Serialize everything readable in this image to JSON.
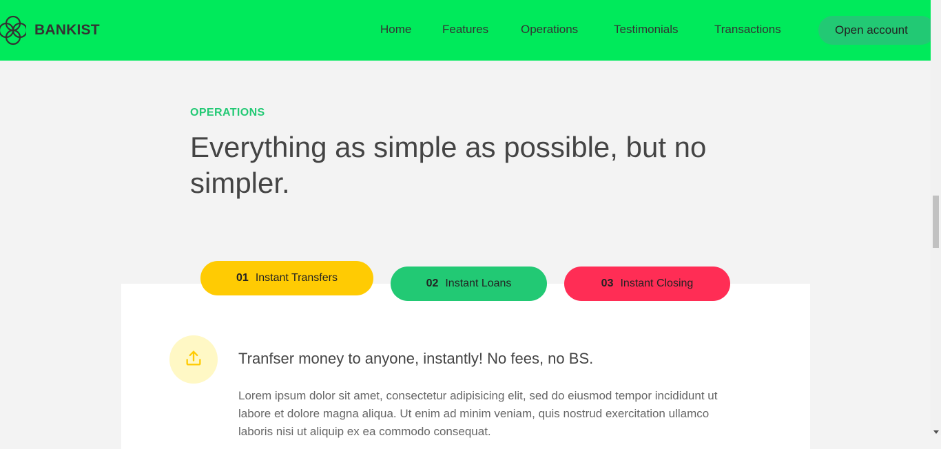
{
  "nav": {
    "brand": "BANKIST",
    "links": [
      "Home",
      "Features",
      "Operations",
      "Testimonials",
      "Transactions"
    ],
    "cta": "Open account"
  },
  "section": {
    "label": "OPERATIONS",
    "title": "Everything as simple as possible, but no simpler."
  },
  "tabs": [
    {
      "num": "01",
      "label": "Instant Transfers"
    },
    {
      "num": "02",
      "label": "Instant Loans"
    },
    {
      "num": "03",
      "label": "Instant Closing"
    }
  ],
  "content": {
    "icon": "upload-icon",
    "heading": "Tranfser money to anyone, instantly! No fees, no BS.",
    "text": "Lorem ipsum dolor sit amet, consectetur adipisicing elit, sed do eiusmod tempor incididunt ut labore et dolore magna aliqua. Ut enim ad minim veniam, quis nostrud exercitation ullamco laboris nisi ut aliquip ex ea commodo consequat."
  },
  "colors": {
    "nav_bg": "#00ea5b",
    "accent_green": "#22c974",
    "tab_yellow": "#ffcb03",
    "tab_red": "#ff2d55",
    "icon_bg": "#fff8c5"
  }
}
